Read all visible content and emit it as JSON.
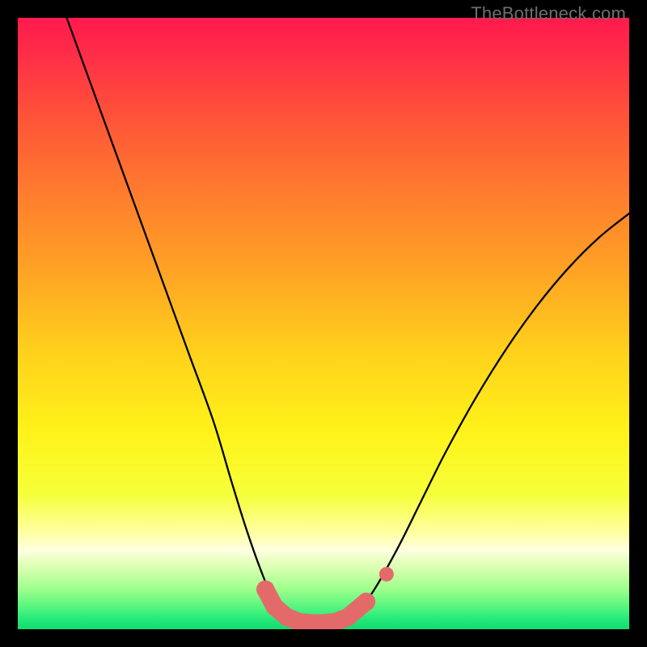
{
  "watermark": "TheBottleneck.com",
  "colors": {
    "bg": "#000000",
    "gradient_stops": [
      {
        "offset": 0.0,
        "color": "#ff1a4d"
      },
      {
        "offset": 0.05,
        "color": "#ff2a49"
      },
      {
        "offset": 0.15,
        "color": "#ff4f3a"
      },
      {
        "offset": 0.28,
        "color": "#ff7a2e"
      },
      {
        "offset": 0.42,
        "color": "#ffa524"
      },
      {
        "offset": 0.55,
        "color": "#ffd21c"
      },
      {
        "offset": 0.68,
        "color": "#fff31a"
      },
      {
        "offset": 0.78,
        "color": "#f6ff3a"
      },
      {
        "offset": 0.845,
        "color": "#ffffa8"
      },
      {
        "offset": 0.87,
        "color": "#ffffe0"
      },
      {
        "offset": 0.9,
        "color": "#d8ffb0"
      },
      {
        "offset": 0.935,
        "color": "#9cff8c"
      },
      {
        "offset": 0.965,
        "color": "#52f57e"
      },
      {
        "offset": 0.985,
        "color": "#22e87a"
      },
      {
        "offset": 1.0,
        "color": "#14d96f"
      }
    ],
    "curve": "#000000",
    "marker_fill": "#e46a6a",
    "marker_stroke": "#e46a6a"
  },
  "chart_data": {
    "type": "line",
    "title": "",
    "xlabel": "",
    "ylabel": "",
    "xlim": [
      0,
      100
    ],
    "ylim": [
      0,
      100
    ],
    "series": [
      {
        "name": "bottleneck-curve",
        "x": [
          8,
          12,
          16,
          20,
          24,
          28,
          32,
          35,
          37.5,
          40,
          42,
          44,
          46,
          48,
          50,
          52,
          55,
          58,
          62,
          66,
          70,
          75,
          80,
          85,
          90,
          95,
          100
        ],
        "y": [
          100,
          89,
          78,
          67,
          56,
          45,
          34,
          24,
          16,
          9,
          4.5,
          2.2,
          1.2,
          1.0,
          1.0,
          1.2,
          2.5,
          6,
          13,
          21,
          29,
          38,
          46,
          53,
          59,
          64,
          68
        ]
      }
    ],
    "markers": {
      "name": "highlight-bottom",
      "x": [
        40.5,
        42,
        44,
        46,
        48,
        50,
        52,
        54,
        57
      ],
      "y": [
        6.5,
        3.7,
        2.0,
        1.2,
        1.0,
        1.0,
        1.2,
        2.0,
        4.5
      ],
      "size": 11
    },
    "extra_marker": {
      "name": "outlier-marker",
      "x": 60.3,
      "y": 9.0,
      "size": 9
    }
  }
}
